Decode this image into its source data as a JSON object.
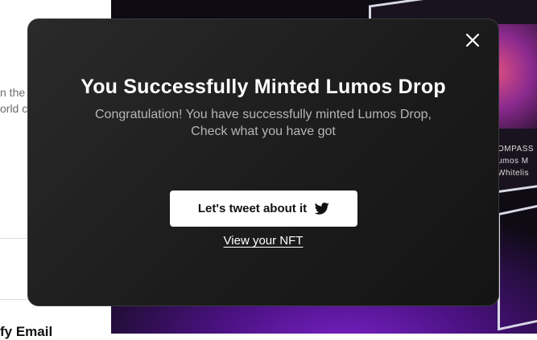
{
  "background": {
    "left_fragment_1": "n the c",
    "left_fragment_2": "orld c",
    "left_heading_fragment": "fy Email",
    "card_text_1": "OMPASS",
    "card_text_2": "umos M",
    "card_text_3": "Whitelis"
  },
  "modal": {
    "title": "You Successfully Minted Lumos Drop",
    "subtitle_line1": "Congratulation! You have successfully minted Lumos Drop,",
    "subtitle_line2": "Check what you have got",
    "tweet_button_label": "Let's tweet about it",
    "tweet_icon": "twitter-bird-icon",
    "view_nft_label": "View your NFT",
    "close_icon": "close-icon"
  },
  "colors": {
    "modal_bg": "#1c1c1c",
    "button_bg": "#ffffff",
    "accent_glow": "#7a22c9"
  }
}
